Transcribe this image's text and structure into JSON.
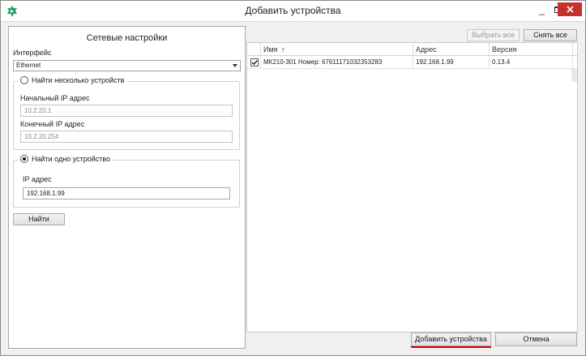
{
  "window": {
    "title": "Добавить устройства",
    "minimize_glyph": "_",
    "close_color": "#c7312a",
    "accent_color": "#2aa36b"
  },
  "left": {
    "heading": "Сетевые настройки",
    "interface_label": "Интерфейс",
    "interface_value": "Ethernet",
    "multi": {
      "radio_label": "Найти несколько устройств",
      "start_ip_label": "Начальный IP адрес",
      "start_ip_value": "10.2.20.1",
      "end_ip_label": "Конечный IP адрес",
      "end_ip_value": "10.2.20.254"
    },
    "single": {
      "radio_label": "Найти одно устройство",
      "ip_label": "IP адрес",
      "ip_value": "192.168.1.99"
    },
    "find_button": "Найти"
  },
  "right": {
    "select_all_button": "Выбрать все",
    "deselect_all_button": "Снять все",
    "columns": [
      "Имя",
      "Адрес",
      "Версия"
    ],
    "rows": [
      {
        "checked": true,
        "name": "МК210-301 Номер: 67611171032353283",
        "address": "192.168.1.99",
        "version": "0.13.4"
      }
    ]
  },
  "footer": {
    "add_button": "Добавить устройства",
    "cancel_button": "Отмена",
    "highlight_color": "#d40000"
  }
}
